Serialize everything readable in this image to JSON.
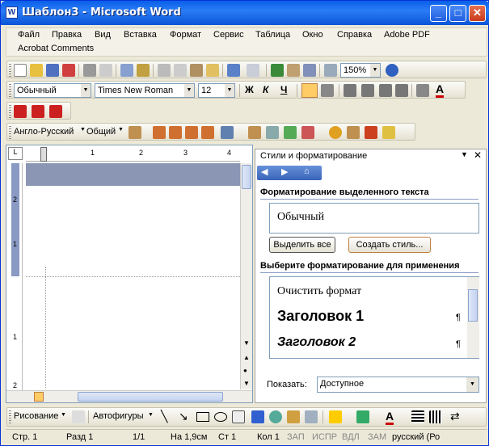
{
  "window": {
    "title": "Шаблон3 - Microsoft Word"
  },
  "menu": {
    "items": [
      "Файл",
      "Правка",
      "Вид",
      "Вставка",
      "Формат",
      "Сервис",
      "Таблица",
      "Окно",
      "Справка",
      "Adobe PDF"
    ],
    "second_row": "Acrobat Comments"
  },
  "standard_toolbar": {
    "zoom": "150%"
  },
  "format_toolbar": {
    "style": "Обычный",
    "font": "Times New Roman",
    "size": "12",
    "bold": "Ж",
    "italic": "К",
    "underline": "Ч"
  },
  "translate_toolbar": {
    "dictionary": "Англо-Русский",
    "topic": "Общий"
  },
  "ruler": {
    "ticks": [
      "1",
      "2",
      "3",
      "4"
    ],
    "vticks": [
      "2",
      "1",
      "1",
      "2"
    ]
  },
  "task_pane": {
    "title": "Стили и форматирование",
    "selected_heading": "Форматирование выделенного текста",
    "current_style": "Обычный",
    "select_all": "Выделить все",
    "new_style": "Создать стиль...",
    "apply_heading": "Выберите форматирование для применения",
    "styles": [
      "Очистить формат",
      "Заголовок 1",
      "Заголовок 2"
    ],
    "pilcrow": "¶",
    "show_label": "Показать:",
    "show_value": "Доступное"
  },
  "drawing_toolbar": {
    "draw": "Рисование",
    "autoshapes": "Автофигуры"
  },
  "status": {
    "page": "Стр. 1",
    "section": "Разд 1",
    "pages": "1/1",
    "at": "На 1,9см",
    "line": "Ст 1",
    "col": "Кол 1",
    "rec": "ЗАП",
    "trk": "ИСПР",
    "ext": "ВДЛ",
    "ovr": "ЗАМ",
    "lang": "русский (Ро"
  },
  "colors": {
    "title": "#0a5fe8",
    "accent_red": "#cc0000",
    "highlight": "#ffcc33"
  }
}
